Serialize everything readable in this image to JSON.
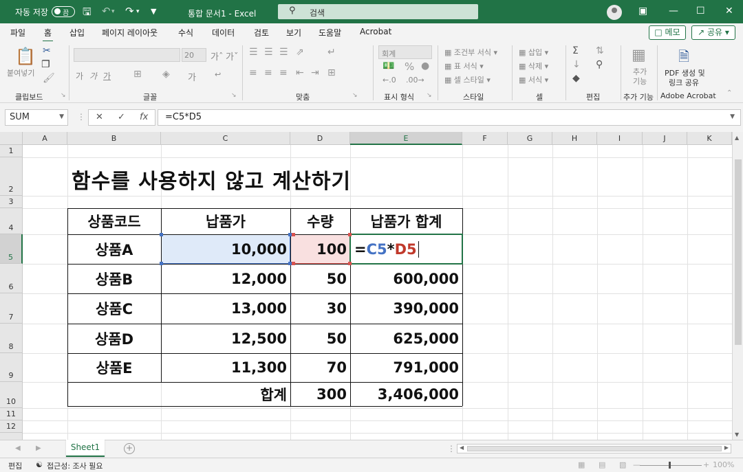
{
  "titlebar": {
    "autosave_label": "자동 저장",
    "autosave_state": "끔",
    "document_title": "통합 문서1 - Excel",
    "search_placeholder": "검색"
  },
  "menu": {
    "tabs": [
      "파일",
      "홈",
      "삽입",
      "페이지 레이아웃",
      "수식",
      "데이터",
      "검토",
      "보기",
      "도움말",
      "Acrobat"
    ],
    "active_tab": "홈",
    "memo_button": "메모",
    "share_button": "공유"
  },
  "ribbon": {
    "groups": [
      "클립보드",
      "글꼴",
      "맞춤",
      "표시 형식",
      "스타일",
      "셀",
      "편집",
      "추가 기능",
      "Adobe Acrobat"
    ],
    "paste_label": "붙여넣기",
    "font_size": "20",
    "number_format": "회계",
    "conditional_format": "조건부 서식",
    "format_as_table": "표 서식",
    "cell_styles": "셀 스타일",
    "insert_cells": "삽입",
    "delete_cells": "삭제",
    "format_cells": "서식",
    "addins_label": "추가 기능",
    "pdf_label_line1": "PDF 생성 및",
    "pdf_label_line2": "링크 공유"
  },
  "formula_bar": {
    "name_box": "SUM",
    "formula": "=C5*D5"
  },
  "grid": {
    "columns": [
      "A",
      "B",
      "C",
      "D",
      "E",
      "F",
      "G",
      "H",
      "I",
      "J",
      "K"
    ],
    "selected_column": "E",
    "rows": [
      "1",
      "2",
      "3",
      "4",
      "5",
      "6",
      "7",
      "8",
      "9",
      "10",
      "11",
      "12"
    ],
    "selected_row": "5"
  },
  "sheet": {
    "title": "함수를 사용하지 않고 계산하기",
    "headers": [
      "상품코드",
      "납품가",
      "수량",
      "납품가 합계"
    ],
    "rows": [
      {
        "code": "상품A",
        "price": "10,000",
        "qty": "100",
        "total": ""
      },
      {
        "code": "상품B",
        "price": "12,000",
        "qty": "50",
        "total": "600,000"
      },
      {
        "code": "상품C",
        "price": "13,000",
        "qty": "30",
        "total": "390,000"
      },
      {
        "code": "상품D",
        "price": "12,500",
        "qty": "50",
        "total": "625,000"
      },
      {
        "code": "상품E",
        "price": "11,300",
        "qty": "70",
        "total": "791,000"
      }
    ],
    "sum_label": "합계",
    "sum_qty": "300",
    "sum_total": "3,406,000",
    "editing_formula": {
      "eq": "=",
      "ref1": "C5",
      "op": "*",
      "ref2": "D5"
    }
  },
  "tabs": {
    "sheet_name": "Sheet1"
  },
  "status": {
    "mode": "편집",
    "accessibility": "접근성: 조사 필요",
    "zoom": "100%"
  },
  "colors": {
    "accent": "#217346",
    "ref_blue": "#4472c4",
    "ref_red": "#c0392b"
  }
}
